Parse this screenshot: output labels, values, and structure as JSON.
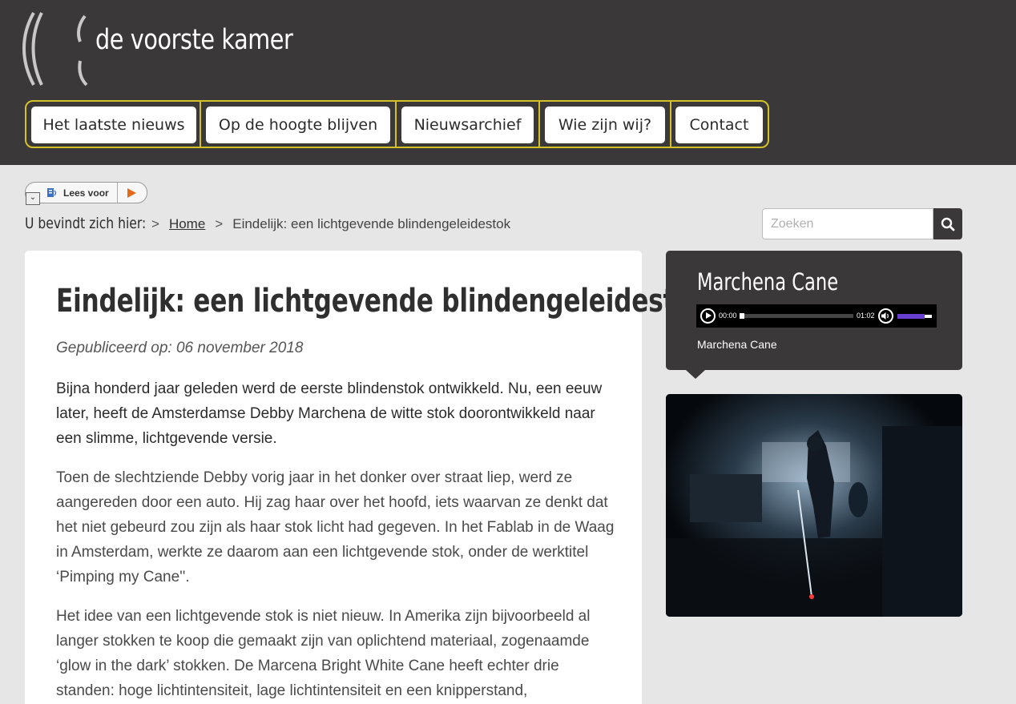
{
  "site": {
    "name": "de voorste kamer"
  },
  "nav": [
    {
      "label": "Het laatste nieuws"
    },
    {
      "label": "Op de hoogte blijven"
    },
    {
      "label": "Nieuwsarchief"
    },
    {
      "label": "Wie zijn wij?"
    },
    {
      "label": "Contact"
    }
  ],
  "readspeaker": {
    "label": "Lees voor",
    "dropdown": "⌄"
  },
  "breadcrumb": {
    "lead": "U bevindt zich hier:",
    "sep": ">",
    "home": "Home",
    "current": "Eindelijk: een lichtgevende blindengeleidestok"
  },
  "search": {
    "placeholder": "Zoeken"
  },
  "article": {
    "title": "Eindelijk: een lichtgevende blindengeleidestok",
    "published": "Gepubliceerd op: 06 november 2018",
    "lead": "Bijna honderd jaar geleden werd de eerste blindenstok ontwikkeld. Nu, een eeuw later, heeft de Amsterdamse Debby Marchena de witte stok doorontwikkeld naar een slimme, lichtgevende versie.",
    "p1": "Toen de slechtziende Debby vorig jaar in het donker over straat liep, werd ze aangereden door een auto. Hij zag haar over het hoofd, iets waarvan ze denkt dat het niet gebeurd zou zijn als haar stok licht had gegeven. In het Fablab in de Waag in Amsterdam, werkte ze daarom aan een lichtgevende stok, onder de werktitel ‘Pimping my Cane''.",
    "p2": "Het idee van een lichtgevende stok is niet nieuw. In Amerika zijn bijvoorbeeld al langer stokken te koop die gemaakt zijn van oplichtend materiaal, zogenaamde ‘glow in the dark’ stokken. De Marcena Bright White Cane heeft echter drie standen: hoge lichtintensiteit, lage lichtintensiteit en een knipperstand,"
  },
  "audio": {
    "title": "Marchena Cane",
    "current_time": "00:00",
    "duration": "01:02",
    "progress": 0.0,
    "volume": 0.8,
    "caption": "Marchena Cane"
  },
  "colors": {
    "header": "#3a3838",
    "nav_border": "#d4c027",
    "page_bg": "#e6e6e6",
    "volume_accent": "#6a3fd0",
    "play_accent": "#e26a1a"
  }
}
